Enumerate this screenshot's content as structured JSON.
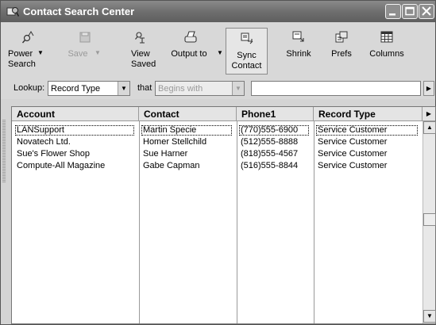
{
  "window": {
    "title": "Contact Search Center"
  },
  "toolbar": {
    "power_search": {
      "line1": "Power",
      "line2": "Search"
    },
    "save": "Save",
    "view_saved": {
      "line1": "View",
      "line2": "Saved"
    },
    "output_to": "Output to",
    "sync_contact": {
      "line1": "Sync",
      "line2": "Contact"
    },
    "shrink": "Shrink",
    "prefs": "Prefs",
    "columns": "Columns"
  },
  "lookup": {
    "label": "Lookup:",
    "field_value": "Record Type",
    "that_label": "that",
    "operator_value": "Begins with",
    "search_value": ""
  },
  "grid": {
    "columns": [
      "Account",
      "Contact",
      "Phone1",
      "Record Type"
    ],
    "rows": [
      {
        "account": "LANSupport",
        "contact": "Martin Specie",
        "phone": "(770)555-6900",
        "type": "Service Customer"
      },
      {
        "account": "Novatech Ltd.",
        "contact": "Homer Stellchild",
        "phone": "(512)555-8888",
        "type": "Service Customer"
      },
      {
        "account": "Sue's Flower Shop",
        "contact": "Sue Harner",
        "phone": "(818)555-4567",
        "type": "Service Customer"
      },
      {
        "account": "Compute-All Magazine",
        "contact": "Gabe Capman",
        "phone": "(516)555-8844",
        "type": "Service Customer"
      }
    ]
  },
  "icons": {
    "app": "contact-search-icon",
    "power_search": "magnifier-icon",
    "save": "floppy-disk-icon",
    "view_saved": "view-saved-icon",
    "output_to": "printer-icon",
    "sync_contact": "sync-icon",
    "shrink": "shrink-icon",
    "prefs": "preferences-icon",
    "columns": "grid-columns-icon"
  }
}
